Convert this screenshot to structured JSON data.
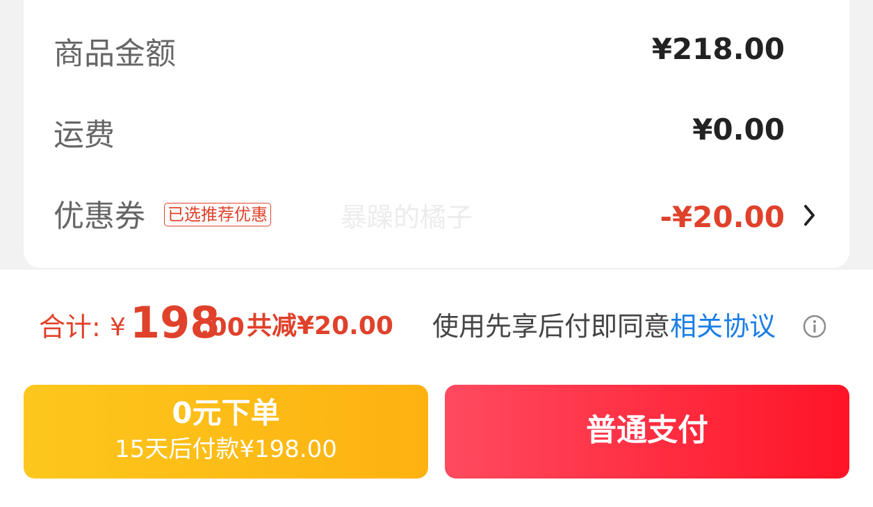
{
  "summary": {
    "rows": [
      {
        "label": "商品金额",
        "value": "¥218.00"
      },
      {
        "label": "运费",
        "value": "¥0.00"
      },
      {
        "label": "优惠券",
        "value": "-¥20.00",
        "badge": "已选推荐优惠"
      }
    ],
    "watermark": "暴躁的橘子"
  },
  "footer": {
    "total_label": "合计:",
    "currency": "¥",
    "total_integer": "198",
    "total_decimal": ".00",
    "reduction": "共减¥20.00",
    "agreement_text": "使用先享后付即同意",
    "agreement_link": "相关协议"
  },
  "buttons": {
    "pay_later_main": "0元下单",
    "pay_later_sub": "15天后付款¥198.00",
    "pay_now": "普通支付"
  },
  "colors": {
    "accent_red": "#e0412b",
    "link_blue": "#1b7ee6",
    "pay_later_yellow": "#fdc71d",
    "pay_now_red": "#ff1427"
  },
  "icons": {
    "coupon_chevron": "chevron-right-icon",
    "agreement_info": "info-icon"
  }
}
